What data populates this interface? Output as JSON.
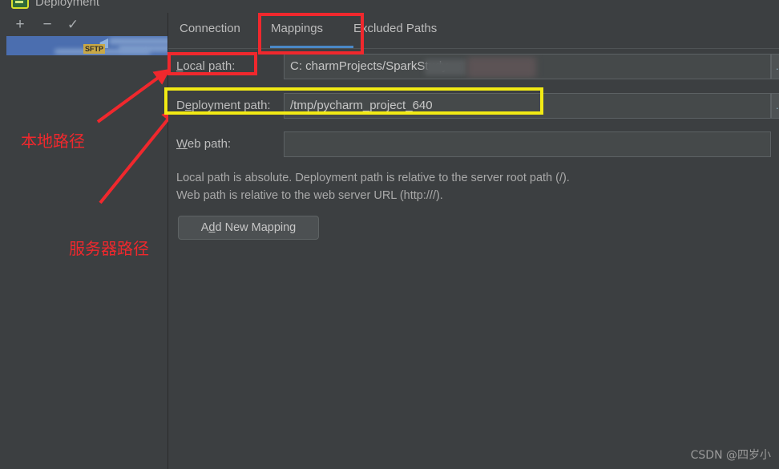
{
  "window": {
    "title": "Deployment",
    "icon": "deployment-icon"
  },
  "sidebar": {
    "toolbar": {
      "add_label": "+",
      "remove_label": "−",
      "confirm_label": "✓"
    },
    "servers": [
      {
        "badge": "SFTP",
        "name": "",
        "redacted": true,
        "selected": true
      }
    ]
  },
  "annotations": {
    "local_path_note": "本地路径",
    "server_path_note": "服务器路径",
    "highlight_red": "#f0282d",
    "highlight_yellow": "#f2ea14",
    "arrow_color": "#f0282d"
  },
  "main": {
    "tabs": [
      {
        "label": "Connection",
        "active": false
      },
      {
        "label": "Mappings",
        "active": true
      },
      {
        "label": "Excluded Paths",
        "active": false
      }
    ],
    "active_tab_accent": "#4a88c7",
    "fields": [
      {
        "label": "Local path:",
        "mnemonic": "L",
        "value": "C:                   charmProjects/SparkStudy",
        "value_visible_head": "C",
        "value_visible_tail": "charmProjects/SparkStudy",
        "redacted": true,
        "browse_label": "…"
      },
      {
        "label": "Deployment path:",
        "mnemonic": "D",
        "value": "/tmp/pycharm_project_640",
        "redacted": false,
        "browse_label": "…"
      },
      {
        "label": "Web path:",
        "mnemonic": "W",
        "value": "",
        "redacted": false,
        "browse_label": ""
      }
    ],
    "description_line1": "Local path is absolute. Deployment path is relative to the server root path (/).",
    "description_line2": "Web path is relative to the web server URL (http:///).",
    "add_mapping_button": {
      "prefix": "A",
      "mnemonic": "d",
      "suffix": "d New Mapping"
    }
  },
  "watermark": {
    "text": "CSDN @四岁小"
  }
}
